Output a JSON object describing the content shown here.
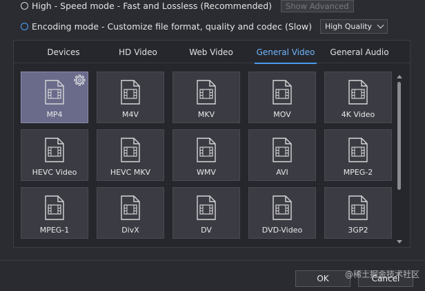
{
  "modes": {
    "high": {
      "label": "High - Speed mode - Fast and Lossless (Recommended)",
      "selected": false
    },
    "show_advanced_label": "Show Advanced",
    "encoding": {
      "label": "Encoding mode - Customize file format, quality and codec (Slow)",
      "selected": true
    },
    "quality_select": {
      "value": "High Quality"
    }
  },
  "tabs": [
    {
      "label": "Devices"
    },
    {
      "label": "HD Video"
    },
    {
      "label": "Web Video"
    },
    {
      "label": "General Video",
      "active": true
    },
    {
      "label": "General Audio"
    }
  ],
  "formats": [
    {
      "label": "MP4",
      "selected": true
    },
    {
      "label": "M4V"
    },
    {
      "label": "MKV"
    },
    {
      "label": "MOV"
    },
    {
      "label": "4K Video"
    },
    {
      "label": "HEVC Video"
    },
    {
      "label": "HEVC MKV"
    },
    {
      "label": "WMV"
    },
    {
      "label": "AVI"
    },
    {
      "label": "MPEG-2"
    },
    {
      "label": "MPEG-1"
    },
    {
      "label": "DivX"
    },
    {
      "label": "DV"
    },
    {
      "label": "DVD-Video"
    },
    {
      "label": "3GP2"
    }
  ],
  "footer": {
    "ok_label": "OK",
    "cancel_label": "Cancel"
  },
  "watermark": "@稀土掘金技术社区",
  "colors": {
    "accent": "#4a9bf0",
    "selected_tile": "#6a6b8a"
  }
}
